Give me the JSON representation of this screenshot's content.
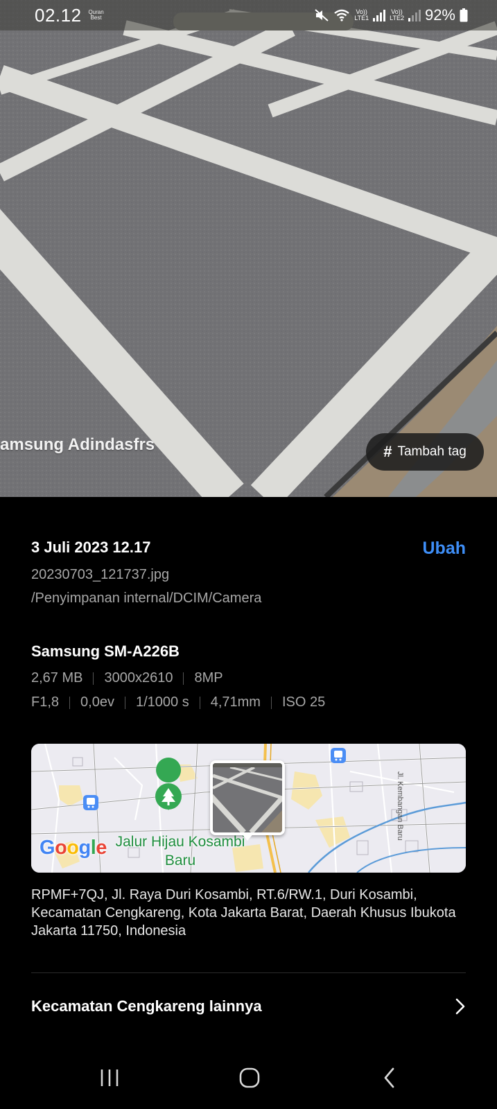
{
  "status_bar": {
    "time": "02.12",
    "app_badge": "Quran Best",
    "sim1_label": "LTE1",
    "sim2_label": "LTE2",
    "volte_label": "Vo))",
    "battery": "92%",
    "icons": [
      "mute-icon",
      "wifi-icon",
      "signal-icon",
      "battery-icon"
    ]
  },
  "photo": {
    "watermark": "amsung Adindasfrs",
    "tag_button_label": "Tambah tag",
    "tag_icon": "#"
  },
  "details": {
    "date_time": "3 Juli 2023 12.17",
    "edit_label": "Ubah",
    "filename": "20230703_121737.jpg",
    "path": "/Penyimpanan internal/DCIM/Camera",
    "device": "Samsung SM-A226B",
    "file_specs": [
      "2,67 MB",
      "3000x2610",
      "8MP"
    ],
    "camera_specs": [
      "F1,8",
      "0,0ev",
      "1/1000 s",
      "4,71mm",
      "ISO 25"
    ]
  },
  "map": {
    "logo": "Google",
    "poi_name": "Jalur Hijau Kosambi Baru",
    "street_label": "Jl. Kembangan Baru",
    "colors": {
      "land": "#ecebf1",
      "road": "#ffffff",
      "water": "#5b9bd8",
      "highway": "#f4c04d",
      "park": "#34a853"
    }
  },
  "address": "RPMF+7QJ, Jl. Raya Duri Kosambi, RT.6/RW.1, Duri Kosambi, Kecamatan Cengkareng, Kota Jakarta Barat, Daerah Khusus Ibukota Jakarta 11750, Indonesia",
  "more_link": {
    "label": "Kecamatan Cengkareng lainnya"
  },
  "accent_color": "#3e8ef7"
}
